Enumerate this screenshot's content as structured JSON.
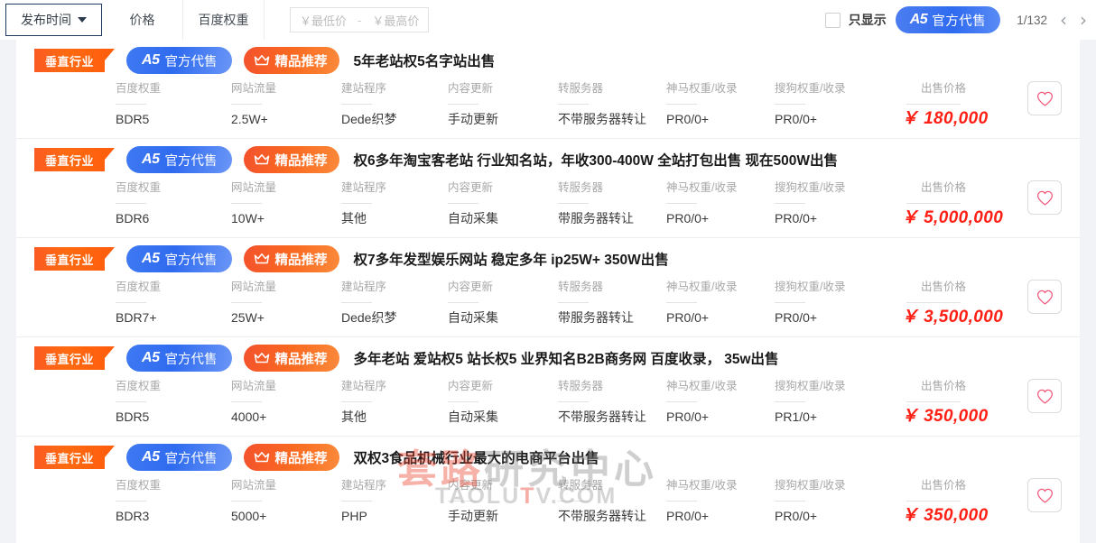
{
  "filterbar": {
    "tabs": [
      {
        "label": "发布时间",
        "active": true,
        "has_caret": true
      },
      {
        "label": "价格",
        "active": false,
        "has_caret": false
      },
      {
        "label": "百度权重",
        "active": false,
        "has_caret": false
      }
    ],
    "price_range": {
      "min_placeholder": "￥最低价",
      "separator": "-",
      "max_placeholder": "￥最高价"
    },
    "only_show_label": "只显示",
    "official_pill": {
      "mark": "A5",
      "label": "官方代售"
    },
    "page_indicator": "1/132",
    "prev_arrow": "‹",
    "next_arrow": "›"
  },
  "spec_labels": {
    "baidu_weight": "百度权重",
    "traffic": "网站流量",
    "cms": "建站程序",
    "content_update": "内容更新",
    "server": "转服务器",
    "shenma": "神马权重/收录",
    "sogou": "搜狗权重/收录",
    "price": "出售价格"
  },
  "badges": {
    "ribbon": "垂直行业",
    "official_mark": "A5",
    "official": "官方代售",
    "recommend": "精品推荐"
  },
  "watermark": {
    "cn_red": "套路",
    "cn_gray": "研究中心",
    "en_gray_1": "TAOLU",
    "en_red": "T",
    "en_gray_2": "V.COM"
  },
  "colors": {
    "price_red": "#ff1f14",
    "official_blue": "#2f6bf0",
    "recommend_orange": "#f96a21",
    "ribbon_orange": "#ff5f0d",
    "page_bg": "#f1f3f7"
  },
  "listings": [
    {
      "title": "5年老站权5名字站出售",
      "baidu_weight": "BDR5",
      "traffic": "2.5W+",
      "cms": "Dede织梦",
      "content_update": "手动更新",
      "server": "不带服务器转让",
      "shenma": "PR0/0+",
      "sogou": "PR0/0+",
      "price": "￥ 180,000"
    },
    {
      "title": "权6多年淘宝客老站 行业知名站，年收300-400W 全站打包出售 现在500W出售",
      "baidu_weight": "BDR6",
      "traffic": "10W+",
      "cms": "其他",
      "content_update": "自动采集",
      "server": "带服务器转让",
      "shenma": "PR0/0+",
      "sogou": "PR0/0+",
      "price": "￥ 5,000,000"
    },
    {
      "title": "权7多年发型娱乐网站 稳定多年 ip25W+ 350W出售",
      "baidu_weight": "BDR7+",
      "traffic": "25W+",
      "cms": "Dede织梦",
      "content_update": "自动采集",
      "server": "带服务器转让",
      "shenma": "PR0/0+",
      "sogou": "PR0/0+",
      "price": "￥ 3,500,000"
    },
    {
      "title": "多年老站 爱站权5 站长权5 业界知名B2B商务网 百度收录， 35w出售",
      "baidu_weight": "BDR5",
      "traffic": "4000+",
      "cms": "其他",
      "content_update": "自动采集",
      "server": "不带服务器转让",
      "shenma": "PR0/0+",
      "sogou": "PR1/0+",
      "price": "￥ 350,000"
    },
    {
      "title": "双权3食品机械行业最大的电商平台出售",
      "baidu_weight": "BDR3",
      "traffic": "5000+",
      "cms": "PHP",
      "content_update": "手动更新",
      "server": "不带服务器转让",
      "shenma": "PR0/0+",
      "sogou": "PR0/0+",
      "price": "￥ 350,000"
    }
  ]
}
